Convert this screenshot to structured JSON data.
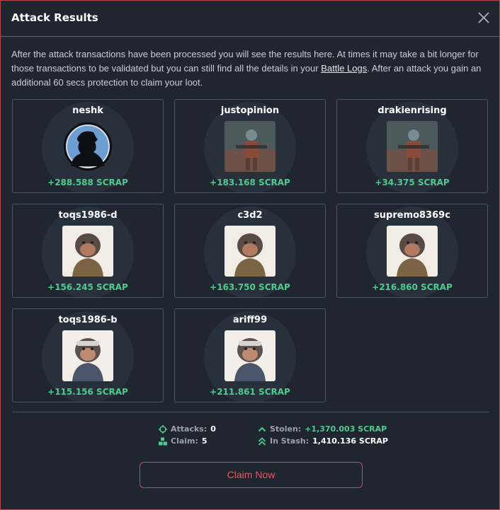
{
  "modal": {
    "title": "Attack Results",
    "description_before": "After the attack transactions have been processed you will see the results here. At times it may take a bit longer for those transactions to be validated but you can still find all the details in your ",
    "link_label": "Battle Logs",
    "description_after": ". After an attack you gain an additional 60 secs protection to claim your loot."
  },
  "results": [
    {
      "name": "neshk",
      "amount": "+288.588 SCRAP",
      "avatar": "silhouette"
    },
    {
      "name": "justopinion",
      "amount": "+183.168 SCRAP",
      "avatar": "soldier"
    },
    {
      "name": "drakienrising",
      "amount": "+34.375 SCRAP",
      "avatar": "soldier"
    },
    {
      "name": "toqs1986-d",
      "amount": "+156.245 SCRAP",
      "avatar": "ape"
    },
    {
      "name": "c3d2",
      "amount": "+163.750 SCRAP",
      "avatar": "ape"
    },
    {
      "name": "supremo8369c",
      "amount": "+216.860 SCRAP",
      "avatar": "ape"
    },
    {
      "name": "toqs1986-b",
      "amount": "+115.156 SCRAP",
      "avatar": "ape-light"
    },
    {
      "name": "ariff99",
      "amount": "+211.861 SCRAP",
      "avatar": "ape-light"
    }
  ],
  "stats": {
    "attacks_label": "Attacks:",
    "attacks_value": "0",
    "claim_label": "Claim:",
    "claim_value": "5",
    "stolen_label": "Stolen:",
    "stolen_value": "+1,370.003 SCRAP",
    "stash_label": "In Stash:",
    "stash_value": "1,410.136 SCRAP"
  },
  "claim_button": "Claim Now",
  "colors": {
    "accent": "#c84c55",
    "green": "#4ecb8d",
    "background": "#1f2630"
  }
}
